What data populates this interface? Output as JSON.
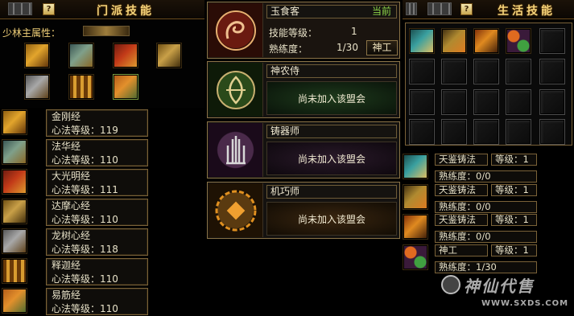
{
  "sect_panel": {
    "title": "门派技能",
    "help": "?",
    "attr_label": "少林主属性：",
    "skills": [
      {
        "name": "金刚经",
        "level": "心法等级：119"
      },
      {
        "name": "法华经",
        "level": "心法等级：110"
      },
      {
        "name": "大光明经",
        "level": "心法等级：111"
      },
      {
        "name": "达摩心经",
        "level": "心法等级：110"
      },
      {
        "name": "龙树心经",
        "level": "心法等级：118"
      },
      {
        "name": "释迦经",
        "level": "心法等级：110"
      },
      {
        "name": "易筋经",
        "level": "心法等级：110"
      }
    ]
  },
  "guilds": {
    "yushike": {
      "name": "玉食客",
      "status": "当前",
      "skill_level_label": "技能等级：",
      "skill_level_value": "1",
      "proficiency_label": "熟练度：",
      "proficiency_value": "1/30",
      "button": "神工"
    },
    "shennong": {
      "name": "神农侍",
      "body": "尚未加入该盟会"
    },
    "zhuqi": {
      "name": "铸器师",
      "body": "尚未加入该盟会"
    },
    "jiqiao": {
      "name": "机巧师",
      "body": "尚未加入该盟会"
    }
  },
  "life_panel": {
    "title": "生活技能",
    "help": "?",
    "entries": [
      {
        "name": "天鉴铸法",
        "level": "等级：1",
        "prof": "熟练度：0/0"
      },
      {
        "name": "天鉴铸法",
        "level": "等级：1",
        "prof": "熟练度：0/0"
      },
      {
        "name": "天鉴铸法",
        "level": "等级：1",
        "prof": "熟练度：0/0"
      },
      {
        "name": "神工",
        "level": "等级：1",
        "prof": "熟练度：1/30"
      }
    ]
  },
  "watermark": {
    "logo_text": "神仙代售",
    "url": "WWW.SXDS.COM"
  }
}
